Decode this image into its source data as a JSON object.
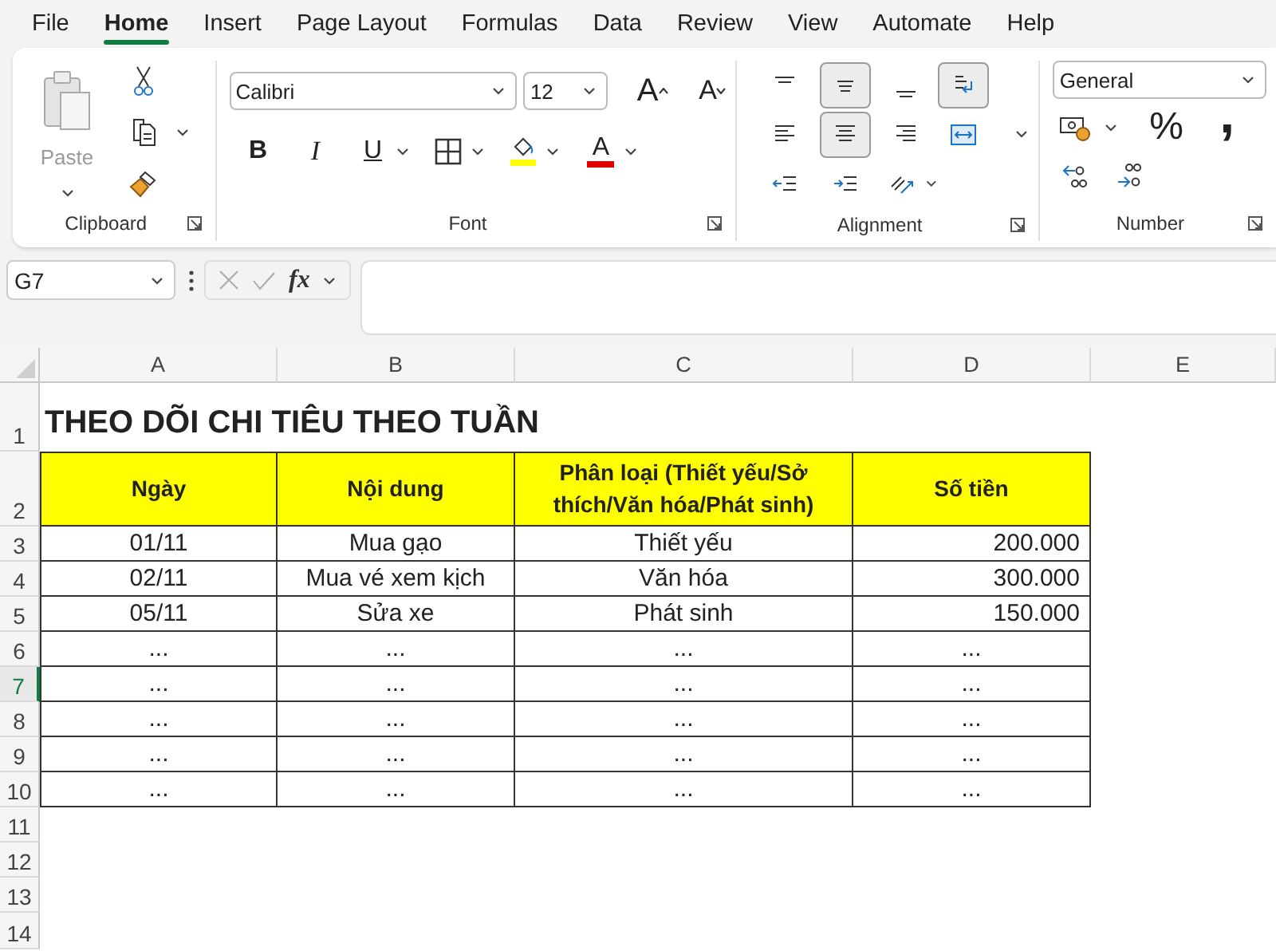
{
  "menu": [
    {
      "label": "File",
      "selected": false
    },
    {
      "label": "Home",
      "selected": true
    },
    {
      "label": "Insert",
      "selected": false
    },
    {
      "label": "Page Layout",
      "selected": false
    },
    {
      "label": "Formulas",
      "selected": false
    },
    {
      "label": "Data",
      "selected": false
    },
    {
      "label": "Review",
      "selected": false
    },
    {
      "label": "View",
      "selected": false
    },
    {
      "label": "Automate",
      "selected": false
    },
    {
      "label": "Help",
      "selected": false
    }
  ],
  "ribbon": {
    "clipboard": {
      "label": "Clipboard",
      "paste": {
        "label": "Paste",
        "disabled": true
      }
    },
    "font": {
      "label": "Font",
      "font_name": "Calibri",
      "font_size": "12",
      "grow_glyph": "A",
      "shrink_glyph": "A",
      "bold_glyph": "B",
      "italic_glyph": "I",
      "underline_glyph": "U",
      "color_glyph": "A"
    },
    "alignment": {
      "label": "Alignment",
      "buttons": [
        {
          "kind": "top",
          "selected": false
        },
        {
          "kind": "middle",
          "selected": true
        },
        {
          "kind": "bottom",
          "selected": false
        },
        {
          "kind": "wrap",
          "selected": true
        },
        {
          "kind": "left",
          "selected": false
        },
        {
          "kind": "center",
          "selected": true
        },
        {
          "kind": "right",
          "selected": false
        },
        {
          "kind": "merge",
          "selected": false
        },
        {
          "kind": "outdent",
          "selected": false
        },
        {
          "kind": "indent",
          "selected": false
        },
        {
          "kind": "orientation",
          "selected": false
        }
      ]
    },
    "number": {
      "label": "Number",
      "format": "General",
      "percent_glyph": "%",
      "comma_glyph": ","
    }
  },
  "formula_bar": {
    "name_box": "G7",
    "function_glyph": "fx"
  },
  "sheet": {
    "column_headers": [
      "A",
      "B",
      "C",
      "D",
      "E"
    ],
    "row_headers": [
      {
        "label": "1",
        "selected": false
      },
      {
        "label": "2",
        "selected": false
      },
      {
        "label": "3",
        "selected": false
      },
      {
        "label": "4",
        "selected": false
      },
      {
        "label": "5",
        "selected": false
      },
      {
        "label": "6",
        "selected": false
      },
      {
        "label": "7",
        "selected": true
      },
      {
        "label": "8",
        "selected": false
      },
      {
        "label": "9",
        "selected": false
      },
      {
        "label": "10",
        "selected": false
      },
      {
        "label": "11",
        "selected": false
      },
      {
        "label": "12",
        "selected": false
      },
      {
        "label": "13",
        "selected": false
      },
      {
        "label": "14",
        "selected": false
      }
    ],
    "title": "THEO DÕI CHI TIÊU THEO TUẦN",
    "table": {
      "columns": [
        "Ngày",
        "Nội dung",
        "Phân loại (Thiết yếu/Sở thích/Văn hóa/Phát sinh)",
        "Số tiền"
      ],
      "rows": [
        {
          "kind": "entry",
          "cells": [
            "01/11",
            "Mua gạo",
            "Thiết yếu",
            "200.000"
          ]
        },
        {
          "kind": "entry",
          "cells": [
            "02/11",
            "Mua vé xem kịch",
            "Văn hóa",
            "300.000"
          ]
        },
        {
          "kind": "entry",
          "cells": [
            "05/11",
            "Sửa xe",
            "Phát sinh",
            "150.000"
          ]
        },
        {
          "kind": "placeholder",
          "cells": [
            "...",
            "...",
            "...",
            "..."
          ]
        },
        {
          "kind": "placeholder",
          "cells": [
            "...",
            "...",
            "...",
            "..."
          ]
        },
        {
          "kind": "placeholder",
          "cells": [
            "...",
            "...",
            "...",
            "..."
          ]
        },
        {
          "kind": "placeholder",
          "cells": [
            "...",
            "...",
            "...",
            "..."
          ]
        },
        {
          "kind": "placeholder",
          "cells": [
            "...",
            "...",
            "...",
            "..."
          ]
        }
      ]
    }
  }
}
